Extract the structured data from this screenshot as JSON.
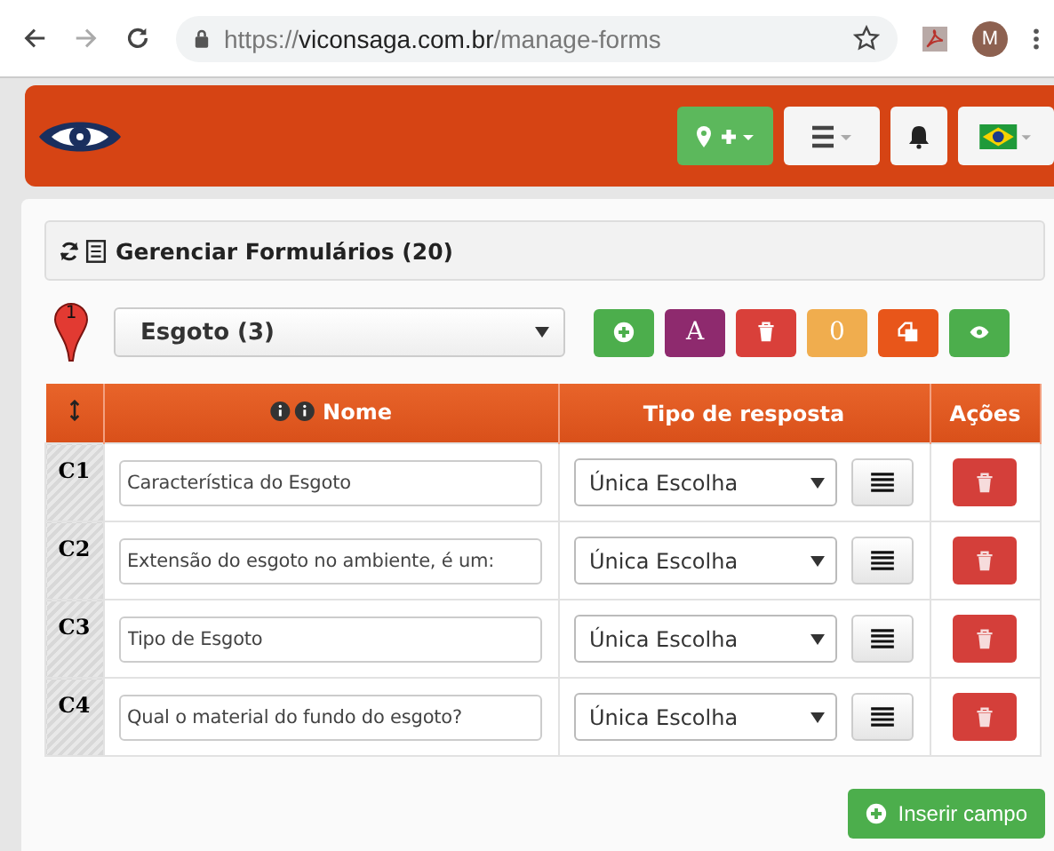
{
  "browser": {
    "url_scheme": "https://",
    "url_host": "viconsaga.com.br",
    "url_path": "/manage-forms",
    "avatar": "M"
  },
  "header": {
    "buttons": [
      {
        "kind": "add-place",
        "color": "#5cb85c"
      },
      {
        "kind": "menu",
        "color": "#f5f5f5"
      },
      {
        "kind": "bell",
        "color": "#f5f5f5"
      },
      {
        "kind": "flag",
        "color": "#f5f5f5"
      }
    ]
  },
  "panel": {
    "title": "Gerenciar Formulários (20)"
  },
  "marker": {
    "label": "1"
  },
  "form_select": {
    "value": "Esgoto (3)"
  },
  "toolbar": [
    {
      "kind": "add",
      "color": "#4cae4c"
    },
    {
      "kind": "text",
      "label": "A",
      "color": "#8e2a6e"
    },
    {
      "kind": "trash",
      "color": "#d9403a"
    },
    {
      "kind": "text",
      "label": "0",
      "color": "#f0ad4e"
    },
    {
      "kind": "copy",
      "color": "#e8561a"
    },
    {
      "kind": "eye",
      "color": "#4cae4c"
    }
  ],
  "table": {
    "columns": [
      "Nome",
      "Tipo de resposta",
      "Ações"
    ],
    "rows": [
      {
        "code": "C1",
        "name": "Característica do Esgoto",
        "type": "Única Escolha"
      },
      {
        "code": "C2",
        "name": "Extensão do esgoto no ambiente, é um:",
        "type": "Única Escolha"
      },
      {
        "code": "C3",
        "name": "Tipo de Esgoto",
        "type": "Única Escolha"
      },
      {
        "code": "C4",
        "name": "Qual o material do fundo do esgoto?",
        "type": "Única Escolha"
      }
    ]
  },
  "insert_button": {
    "label": "Inserir campo"
  }
}
